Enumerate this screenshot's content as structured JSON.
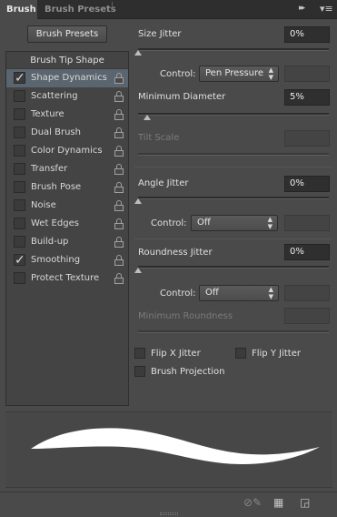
{
  "tabs": [
    {
      "label": "Brush"
    },
    {
      "label": "Brush Presets"
    }
  ],
  "brush_presets_button": "Brush Presets",
  "brush_tip_shape": "Brush Tip Shape",
  "options": [
    {
      "label": "Shape Dynamics",
      "checked": true,
      "selected": true
    },
    {
      "label": "Scattering",
      "checked": false
    },
    {
      "label": "Texture",
      "checked": false
    },
    {
      "label": "Dual Brush",
      "checked": false
    },
    {
      "label": "Color Dynamics",
      "checked": false
    },
    {
      "label": "Transfer",
      "checked": false
    },
    {
      "label": "Brush Pose",
      "checked": false
    },
    {
      "label": "Noise",
      "checked": false
    },
    {
      "label": "Wet Edges",
      "checked": false
    },
    {
      "label": "Build-up",
      "checked": false
    },
    {
      "label": "Smoothing",
      "checked": true
    },
    {
      "label": "Protect Texture",
      "checked": false
    }
  ],
  "size_jitter": {
    "label": "Size Jitter",
    "value": "0%",
    "control_label": "Control:",
    "control_value": "Pen Pressure"
  },
  "minimum_diameter": {
    "label": "Minimum Diameter",
    "value": "5%"
  },
  "tilt_scale": {
    "label": "Tilt Scale"
  },
  "angle_jitter": {
    "label": "Angle Jitter",
    "value": "0%",
    "control_label": "Control:",
    "control_value": "Off"
  },
  "roundness_jitter": {
    "label": "Roundness Jitter",
    "value": "0%",
    "control_label": "Control:",
    "control_value": "Off"
  },
  "minimum_roundness": {
    "label": "Minimum Roundness"
  },
  "flip_x": {
    "label": "Flip X Jitter",
    "checked": false
  },
  "flip_y": {
    "label": "Flip Y Jitter",
    "checked": false
  },
  "brush_projection": {
    "label": "Brush Projection",
    "checked": false
  },
  "icons": [
    "collapse-icon",
    "panel-menu-icon",
    "lock-icon",
    "brush-toggle-icon",
    "grid-icon",
    "new-preset-icon"
  ]
}
